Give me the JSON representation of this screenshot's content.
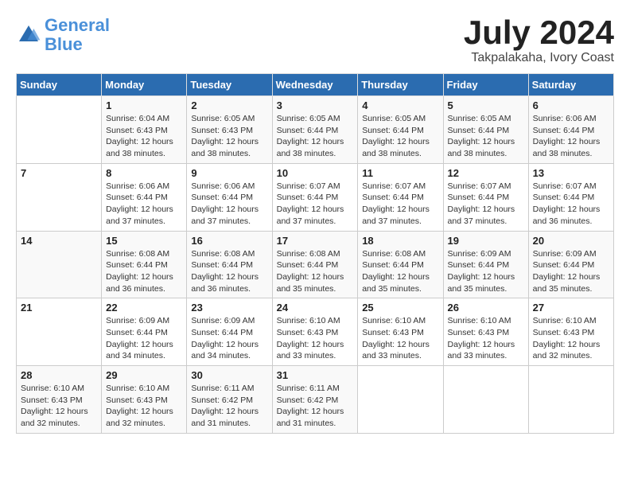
{
  "header": {
    "logo_line1": "General",
    "logo_line2": "Blue",
    "month_year": "July 2024",
    "location": "Takpalakaha, Ivory Coast"
  },
  "calendar": {
    "days_of_week": [
      "Sunday",
      "Monday",
      "Tuesday",
      "Wednesday",
      "Thursday",
      "Friday",
      "Saturday"
    ],
    "weeks": [
      [
        {
          "day": "",
          "info": ""
        },
        {
          "day": "1",
          "info": "Sunrise: 6:04 AM\nSunset: 6:43 PM\nDaylight: 12 hours\nand 38 minutes."
        },
        {
          "day": "2",
          "info": "Sunrise: 6:05 AM\nSunset: 6:43 PM\nDaylight: 12 hours\nand 38 minutes."
        },
        {
          "day": "3",
          "info": "Sunrise: 6:05 AM\nSunset: 6:44 PM\nDaylight: 12 hours\nand 38 minutes."
        },
        {
          "day": "4",
          "info": "Sunrise: 6:05 AM\nSunset: 6:44 PM\nDaylight: 12 hours\nand 38 minutes."
        },
        {
          "day": "5",
          "info": "Sunrise: 6:05 AM\nSunset: 6:44 PM\nDaylight: 12 hours\nand 38 minutes."
        },
        {
          "day": "6",
          "info": "Sunrise: 6:06 AM\nSunset: 6:44 PM\nDaylight: 12 hours\nand 38 minutes."
        }
      ],
      [
        {
          "day": "7",
          "info": ""
        },
        {
          "day": "8",
          "info": "Sunrise: 6:06 AM\nSunset: 6:44 PM\nDaylight: 12 hours\nand 37 minutes."
        },
        {
          "day": "9",
          "info": "Sunrise: 6:06 AM\nSunset: 6:44 PM\nDaylight: 12 hours\nand 37 minutes."
        },
        {
          "day": "10",
          "info": "Sunrise: 6:07 AM\nSunset: 6:44 PM\nDaylight: 12 hours\nand 37 minutes."
        },
        {
          "day": "11",
          "info": "Sunrise: 6:07 AM\nSunset: 6:44 PM\nDaylight: 12 hours\nand 37 minutes."
        },
        {
          "day": "12",
          "info": "Sunrise: 6:07 AM\nSunset: 6:44 PM\nDaylight: 12 hours\nand 37 minutes."
        },
        {
          "day": "13",
          "info": "Sunrise: 6:07 AM\nSunset: 6:44 PM\nDaylight: 12 hours\nand 36 minutes."
        }
      ],
      [
        {
          "day": "14",
          "info": ""
        },
        {
          "day": "15",
          "info": "Sunrise: 6:08 AM\nSunset: 6:44 PM\nDaylight: 12 hours\nand 36 minutes."
        },
        {
          "day": "16",
          "info": "Sunrise: 6:08 AM\nSunset: 6:44 PM\nDaylight: 12 hours\nand 36 minutes."
        },
        {
          "day": "17",
          "info": "Sunrise: 6:08 AM\nSunset: 6:44 PM\nDaylight: 12 hours\nand 35 minutes."
        },
        {
          "day": "18",
          "info": "Sunrise: 6:08 AM\nSunset: 6:44 PM\nDaylight: 12 hours\nand 35 minutes."
        },
        {
          "day": "19",
          "info": "Sunrise: 6:09 AM\nSunset: 6:44 PM\nDaylight: 12 hours\nand 35 minutes."
        },
        {
          "day": "20",
          "info": "Sunrise: 6:09 AM\nSunset: 6:44 PM\nDaylight: 12 hours\nand 35 minutes."
        }
      ],
      [
        {
          "day": "21",
          "info": ""
        },
        {
          "day": "22",
          "info": "Sunrise: 6:09 AM\nSunset: 6:44 PM\nDaylight: 12 hours\nand 34 minutes."
        },
        {
          "day": "23",
          "info": "Sunrise: 6:09 AM\nSunset: 6:44 PM\nDaylight: 12 hours\nand 34 minutes."
        },
        {
          "day": "24",
          "info": "Sunrise: 6:10 AM\nSunset: 6:43 PM\nDaylight: 12 hours\nand 33 minutes."
        },
        {
          "day": "25",
          "info": "Sunrise: 6:10 AM\nSunset: 6:43 PM\nDaylight: 12 hours\nand 33 minutes."
        },
        {
          "day": "26",
          "info": "Sunrise: 6:10 AM\nSunset: 6:43 PM\nDaylight: 12 hours\nand 33 minutes."
        },
        {
          "day": "27",
          "info": "Sunrise: 6:10 AM\nSunset: 6:43 PM\nDaylight: 12 hours\nand 32 minutes."
        }
      ],
      [
        {
          "day": "28",
          "info": "Sunrise: 6:10 AM\nSunset: 6:43 PM\nDaylight: 12 hours\nand 32 minutes."
        },
        {
          "day": "29",
          "info": "Sunrise: 6:10 AM\nSunset: 6:43 PM\nDaylight: 12 hours\nand 32 minutes."
        },
        {
          "day": "30",
          "info": "Sunrise: 6:11 AM\nSunset: 6:42 PM\nDaylight: 12 hours\nand 31 minutes."
        },
        {
          "day": "31",
          "info": "Sunrise: 6:11 AM\nSunset: 6:42 PM\nDaylight: 12 hours\nand 31 minutes."
        },
        {
          "day": "",
          "info": ""
        },
        {
          "day": "",
          "info": ""
        },
        {
          "day": "",
          "info": ""
        }
      ]
    ]
  }
}
